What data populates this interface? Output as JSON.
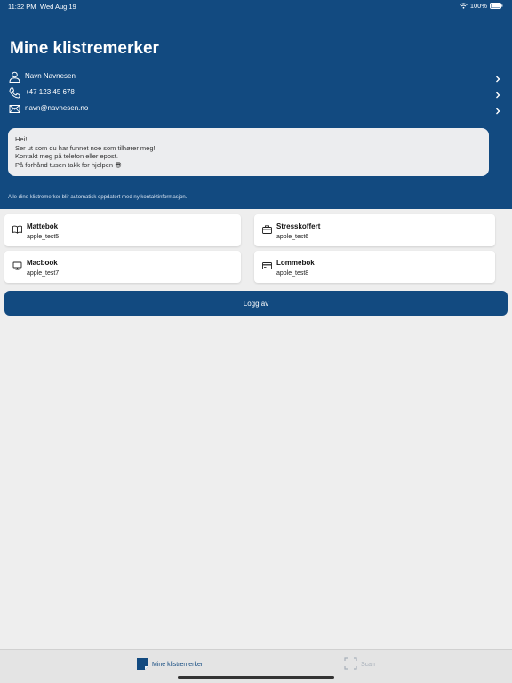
{
  "status_bar": {
    "time": "11:32 PM",
    "date": "Wed Aug 19",
    "battery": "100%"
  },
  "header": {
    "title": "Mine klistremerker",
    "contacts": [
      {
        "icon": "person-icon",
        "label": "Navn Navnesen"
      },
      {
        "icon": "phone-icon",
        "label": "+47 123 45 678"
      },
      {
        "icon": "mail-icon",
        "label": "navn@navnesen.no"
      }
    ],
    "message": {
      "lines": [
        "Hei!",
        "Ser ut som du har funnet noe som tilhører meg!",
        "Kontakt meg på telefon eller epost.",
        "På forhånd tusen takk for hjelpen 😎"
      ]
    },
    "auto_note": "Alle dine klistremerker blir automatisk oppdatert med ny kontaktinformasjon."
  },
  "stickers": [
    {
      "icon": "book-icon",
      "name": "Mattebok",
      "id": "apple_test5"
    },
    {
      "icon": "suitcase-icon",
      "name": "Stresskoffert",
      "id": "apple_test6"
    },
    {
      "icon": "laptop-icon",
      "name": "Macbook",
      "id": "apple_test7"
    },
    {
      "icon": "wallet-icon",
      "name": "Lommebok",
      "id": "apple_test8"
    }
  ],
  "logout_label": "Logg av",
  "tab_bar": {
    "tabs": [
      {
        "icon": "sticker-icon",
        "label": "Mine klistremerker",
        "active": true
      },
      {
        "icon": "scan-icon",
        "label": "Scan",
        "active": false
      }
    ]
  },
  "colors": {
    "brand": "#124a80",
    "background": "#eeeeee",
    "inactive_tab": "#a8b0ba"
  }
}
